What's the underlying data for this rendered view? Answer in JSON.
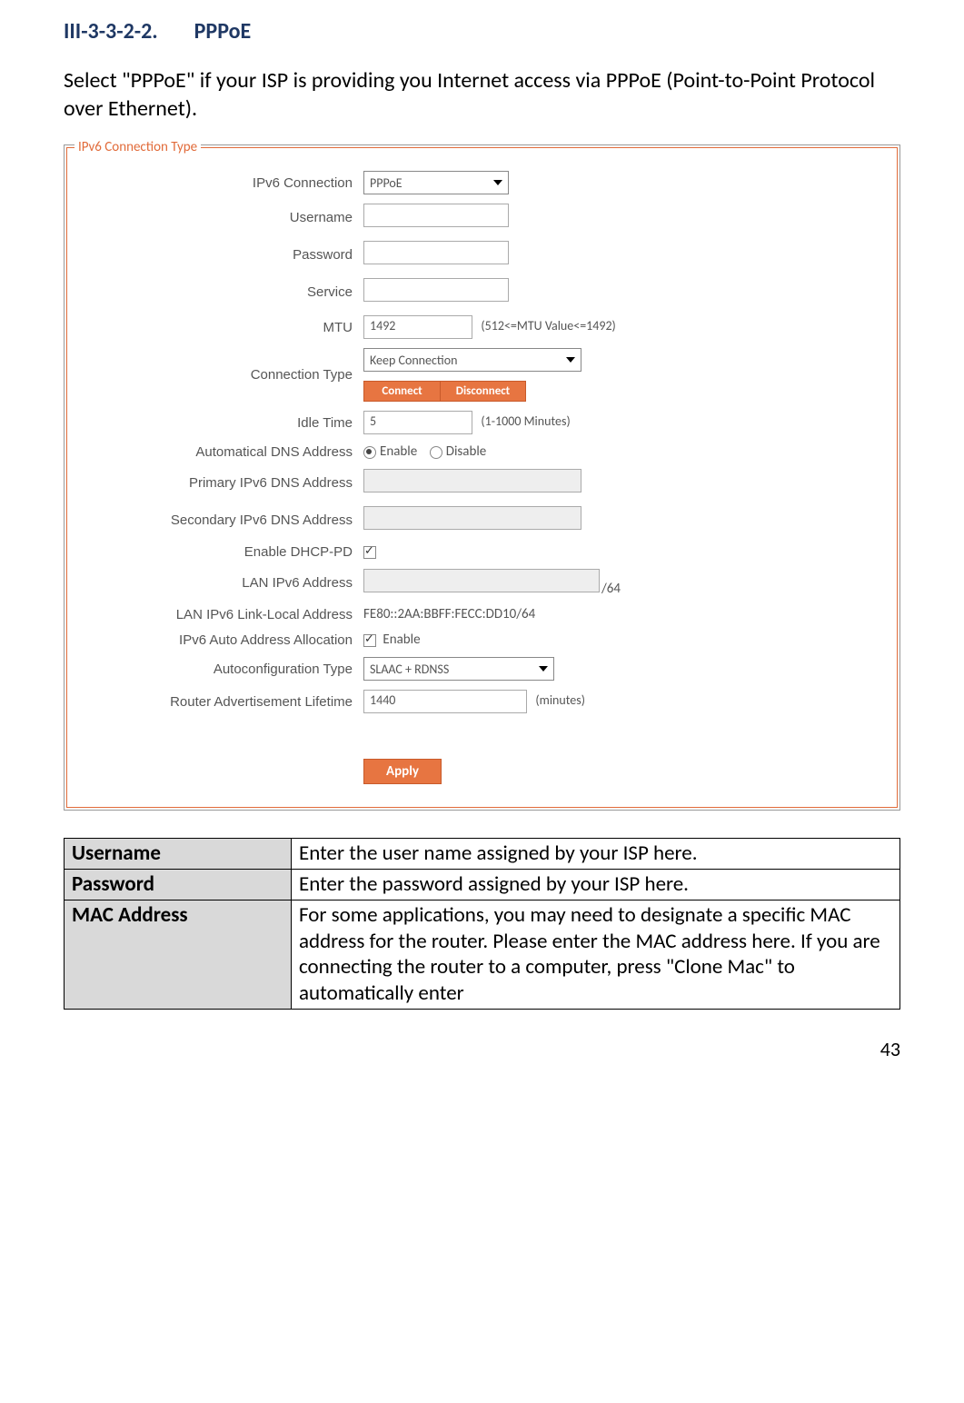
{
  "heading": {
    "number": "III-3-3-2-2.",
    "title": "PPPoE"
  },
  "intro": "Select \"PPPoE\" if your ISP is providing you Internet access via PPPoE (Point-to-Point Protocol over Ethernet).",
  "panel": {
    "legend": "IPv6 Connection Type",
    "rows": {
      "ipv6conn_label": "IPv6 Connection",
      "ipv6conn_value": "PPPoE",
      "username_label": "Username",
      "password_label": "Password",
      "service_label": "Service",
      "mtu_label": "MTU",
      "mtu_value": "1492",
      "mtu_hint": "(512<=MTU Value<=1492)",
      "conntype_label": "Connection Type",
      "conntype_value": "Keep Connection",
      "connect_btn": "Connect",
      "disconnect_btn": "Disconnect",
      "idle_label": "Idle Time",
      "idle_value": "5",
      "idle_hint": "(1-1000 Minutes)",
      "autodns_label": "Automatical DNS Address",
      "enable_opt": "Enable",
      "disable_opt": "Disable",
      "pdns_label": "Primary IPv6 DNS Address",
      "sdns_label": "Secondary IPv6 DNS Address",
      "dhcppd_label": "Enable DHCP-PD",
      "lanipv6_label": "LAN IPv6 Address",
      "lanipv6_suffix": "/64",
      "lanll_label": "LAN IPv6 Link-Local Address",
      "lanll_value": "FE80::2AA:BBFF:FECC:DD10/64",
      "autoaddr_label": "IPv6 Auto Address Allocation",
      "autoaddr_opt": "Enable",
      "autoconf_label": "Autoconfiguration Type",
      "autoconf_value": "SLAAC + RDNSS",
      "ralife_label": "Router Advertisement Lifetime",
      "ralife_value": "1440",
      "ralife_hint": "(minutes)",
      "apply_btn": "Apply"
    }
  },
  "desc_table": [
    {
      "name": "Username",
      "text": "Enter the user name assigned by your ISP here."
    },
    {
      "name": "Password",
      "text": "Enter the password assigned by your ISP here."
    },
    {
      "name": "MAC Address",
      "text": "For some applications, you may need to designate a specific MAC address for the router. Please enter the MAC address here. If you are connecting the router to a computer, press \"Clone Mac\" to automatically enter"
    }
  ],
  "page_number": "43"
}
